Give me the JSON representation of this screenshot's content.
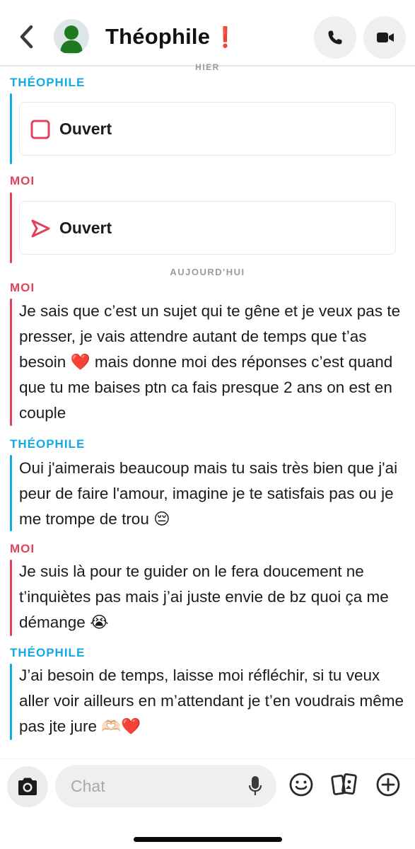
{
  "header": {
    "contact_name": "Théophile",
    "name_emoji": "❗"
  },
  "day_labels": {
    "yesterday": "HIER",
    "today": "AUJOURD'HUI"
  },
  "messages": [
    {
      "sender": "THÉOPHILE",
      "type": "snap-status",
      "status": "Ouvert",
      "icon": "received-snap-square-icon"
    },
    {
      "sender": "MOI",
      "type": "snap-status",
      "status": "Ouvert",
      "icon": "sent-snap-arrow-icon"
    },
    {
      "sender": "MOI",
      "type": "text",
      "text": "Je sais que c’est un sujet qui te gêne et je veux pas te presser, je vais attendre autant de temps que t’as besoin ❤️ mais donne moi des réponses c’est quand que tu me baises ptn ca fais presque 2 ans on est en couple"
    },
    {
      "sender": "THÉOPHILE",
      "type": "text",
      "text": "Oui j'aimerais beaucoup mais tu sais très bien que j'ai peur de faire l'amour, imagine je te satisfais pas ou je me trompe de trou 😔"
    },
    {
      "sender": "MOI",
      "type": "text",
      "text": "Je suis là pour te guider on le fera doucement ne t’inquiètes pas mais j’ai juste envie de bz quoi ça me démange 😭"
    },
    {
      "sender": "THÉOPHILE",
      "type": "text",
      "text": "J’ai besoin de temps, laisse moi réfléchir, si tu veux aller voir ailleurs en m’attendant je t’en voudrais même pas jte jure 🫶🏻❤️"
    }
  ],
  "composer": {
    "placeholder": "Chat"
  },
  "colors": {
    "contact_accent": "#13a9e6",
    "me_accent": "#e0435a"
  }
}
